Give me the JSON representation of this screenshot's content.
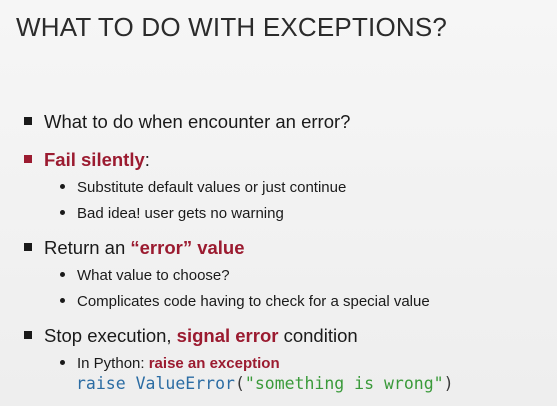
{
  "slide": {
    "title": "WHAT TO DO WITH EXCEPTIONS?",
    "bullets": [
      {
        "text": "What to do when encounter an error?"
      },
      {
        "emph": "Fail silently",
        "after": ":"
      },
      {
        "text": "Substitute default values or just continue"
      },
      {
        "text": "Bad idea! user gets no warning"
      },
      {
        "before": "Return an ",
        "emph": "“error” value"
      },
      {
        "text": "What value to choose?"
      },
      {
        "text": "Complicates code having to check for a special value"
      },
      {
        "before": "Stop execution, ",
        "emph": "signal error",
        "after": " condition"
      },
      {
        "before": "In Python: ",
        "emph": "raise an exception"
      }
    ],
    "code": {
      "keyword": "raise",
      "space": " ",
      "name": "ValueError",
      "open": "(",
      "string": "\"something is wrong\"",
      "close": ")"
    },
    "colors": {
      "emphasis": "#9b1b30",
      "code_keyword": "#2b6ca3",
      "code_string": "#3a9a3a"
    }
  }
}
